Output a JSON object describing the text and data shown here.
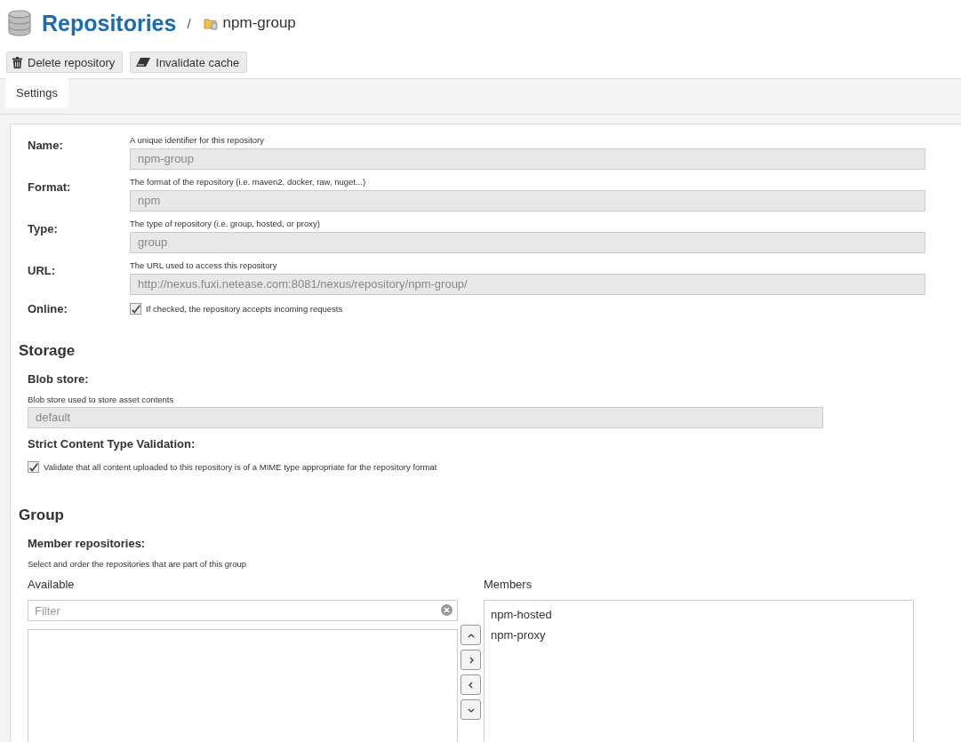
{
  "header": {
    "title": "Repositories",
    "separator": "/",
    "current": "npm-group"
  },
  "toolbar": [
    {
      "label": "Delete repository",
      "kind": "delete"
    },
    {
      "label": "Invalidate cache",
      "kind": "eraser"
    }
  ],
  "tabs": [
    {
      "label": "Settings",
      "selected": true
    }
  ],
  "fields": [
    {
      "label": "Name:",
      "help": "A unique identifier for this repository",
      "value": "npm-group"
    },
    {
      "label": "Format:",
      "help": "The format of the repository (i.e. maven2, docker, raw, nuget...)",
      "value": "npm"
    },
    {
      "label": "Type:",
      "help": "The type of repository (i.e. group, hosted, or proxy)",
      "value": "group"
    },
    {
      "label": "URL:",
      "help": "The URL used to access this repository",
      "value": "http://nexus.fuxi.netease.com:8081/nexus/repository/npm-group/"
    }
  ],
  "online": {
    "label": "Online:",
    "checked": true,
    "help": "If checked, the repository accepts incoming requests"
  },
  "storage": {
    "heading": "Storage",
    "blob_label": "Blob store:",
    "blob_help": "Blob store used to store asset contents",
    "blob_value": "default",
    "strict_label": "Strict Content Type Validation:",
    "strict_checked": true,
    "strict_help": "Validate that all content uploaded to this repository is of a MIME type appropriate for the repository format"
  },
  "group": {
    "heading": "Group",
    "members_label": "Member repositories:",
    "help": "Select and order the repositories that are part of this group",
    "available_title": "Available",
    "filter_placeholder": "Filter",
    "members_title": "Members",
    "members": [
      "npm-hosted",
      "npm-proxy"
    ],
    "move_buttons": [
      {
        "kind": "up"
      },
      {
        "kind": "right"
      },
      {
        "kind": "left"
      },
      {
        "kind": "down"
      }
    ]
  }
}
